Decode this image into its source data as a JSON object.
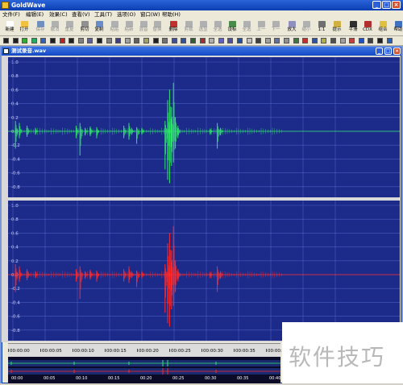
{
  "app": {
    "title": "GoldWave"
  },
  "menu": [
    "文件(F)",
    "编辑(E)",
    "效果(C)",
    "查看(V)",
    "工具(T)",
    "选项(O)",
    "窗口(W)",
    "帮助(H)"
  ],
  "toolbar": [
    {
      "label": "新建",
      "color": "#ffffff"
    },
    {
      "label": "打开",
      "color": "#f0c040"
    },
    {
      "label": "保存",
      "color": "#7090c0",
      "disabled": true
    },
    {
      "label": "撤消",
      "color": "#b0b0b0",
      "disabled": true
    },
    {
      "label": "重复",
      "color": "#b0b0b0",
      "disabled": true
    },
    {
      "label": "剪切",
      "color": "#909090"
    },
    {
      "label": "复制",
      "color": "#6a8cc8"
    },
    {
      "label": "粘贴",
      "color": "#b0b0b0",
      "disabled": true
    },
    {
      "label": "粘新",
      "color": "#b0b0b0",
      "disabled": true
    },
    {
      "label": "混音",
      "color": "#b0b0b0",
      "disabled": true
    },
    {
      "label": "替换",
      "color": "#b0b0b0",
      "disabled": true
    },
    {
      "label": "删除",
      "color": "#c03030"
    },
    {
      "label": "剪裁",
      "color": "#b0b0b0",
      "disabled": true
    },
    {
      "label": "选显",
      "color": "#b0b0b0",
      "disabled": true
    },
    {
      "label": "全选",
      "color": "#b0b0b0",
      "disabled": true
    },
    {
      "label": "设标",
      "color": "#4a8a4a"
    },
    {
      "label": "全选",
      "color": "#b0b0b0",
      "disabled": true
    },
    {
      "label": "上一",
      "color": "#b0b0b0",
      "disabled": true
    },
    {
      "label": "下一",
      "color": "#b0b0b0",
      "disabled": true
    },
    {
      "label": "放大",
      "color": "#9090c0"
    },
    {
      "label": "缩小",
      "color": "#b0b0b0",
      "disabled": true
    },
    {
      "label": "1:1",
      "color": "#707070"
    },
    {
      "label": "提示",
      "color": "#d0b040"
    },
    {
      "label": "平滑",
      "color": "#303030"
    },
    {
      "label": "CDX",
      "color": "#b03030"
    },
    {
      "label": "组合",
      "color": "#e0c040"
    },
    {
      "label": "帮助",
      "color": "#4070c0"
    }
  ],
  "document": {
    "title": "测试录音.wav"
  },
  "waveform": {
    "background": "#1c2a8a",
    "grid_color": "#4a5cc0",
    "y_ticks": [
      "1.0",
      "0.8",
      "0.6",
      "0.4",
      "0.2",
      "0.0",
      "-0.2",
      "-0.4",
      "-0.6",
      "-0.8"
    ],
    "channels": [
      {
        "name": "left",
        "color": "#2ee86a"
      },
      {
        "name": "right",
        "color": "#ff2a2a"
      }
    ]
  },
  "timeline": {
    "labels": [
      "00:00:00",
      "00:00:05",
      "00:00:10",
      "00:00:15",
      "00:00:20",
      "00:00:25",
      "00:00:30",
      "00:00:35",
      "00:00:4"
    ]
  },
  "overview": {
    "labels": [
      "00:00",
      "00:05",
      "00:10",
      "00:15",
      "00:20",
      "00:25",
      "00:30",
      "00:35",
      "00:40"
    ]
  },
  "watermark": {
    "text": "软件技巧"
  }
}
